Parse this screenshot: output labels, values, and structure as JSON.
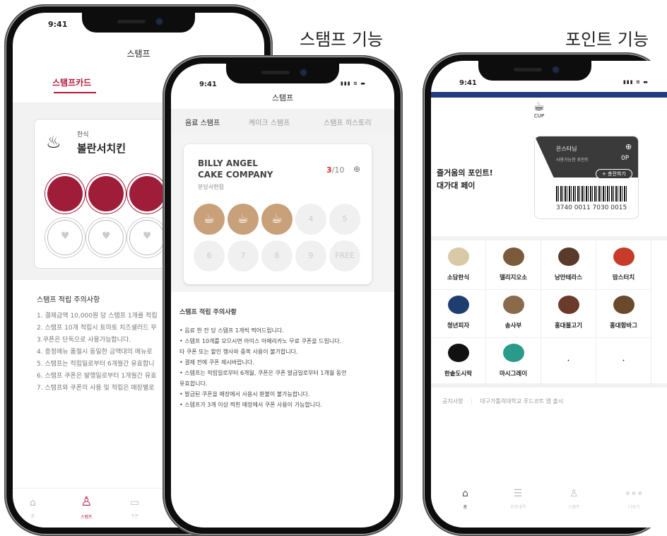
{
  "headings": {
    "stamp": "스탬프 기능",
    "point": "포인트 기능"
  },
  "status": {
    "time": "9:41",
    "icons": "▮▮▮ ≋ ▬"
  },
  "phone1": {
    "title": "스탬프",
    "tab_active": "스탬프카드",
    "store_category": "한식",
    "store_name": "볼란서치킨",
    "heart": "♥",
    "notes_title": "스탬프 적립 주의사항",
    "notes": [
      "1. 결제금액 10,000원 당 스탬프 1개를 적립",
      "2. 스탬프 10개 적립시 토마토 치즈샐러드 무",
      "3.쿠폰은 단독으로 사용가능합니다.",
      "4. 증정메뉴 품절시 동일한 금액대의 메뉴로",
      "5. 스탬프는 적립일로부터 6개월간 유효합니",
      "6. 스탬프 쿠폰은 발행일로부터 1개월간 유효",
      "7. 스탬프와 쿠폰의 사용 및 적립은 매장별로"
    ],
    "nav": [
      "홈",
      "스탬프",
      "쿠폰"
    ]
  },
  "phone2": {
    "title": "스탬프",
    "tabs": [
      "음료 스탬프",
      "케이크 스탬프",
      "스탬프 히스토리"
    ],
    "store_name_1": "BILLY ANGEL",
    "store_name_2": "CAKE COMPANY",
    "branch": "분당서현점",
    "count_current": "3",
    "count_total": "/10",
    "stamps": [
      "",
      "",
      "",
      "4",
      "5",
      "6",
      "7",
      "8",
      "9",
      "FREE"
    ],
    "filled_stamps": 3,
    "notes_title": "스탬프 적립 주의사항",
    "notes": [
      "• 음료 한 잔 당 스탬프 1개씩 찍어드립니다.",
      "• 스탬프 10개를 모으시면 아이스 아메리카노 무료 쿠폰을 드립니다.",
      "  타 쿠폰 또는 할인 행사와 중복 사용이 불가합니다.",
      "• 결제 전에 쿠폰 제시바랍니다.",
      "• 스탬프는 적립일로부터 6개월, 쿠폰은 쿠폰 발급일로부터 1개월 동안",
      "  유효합니다.",
      "• 발급된 쿠폰을 매장에서 사용시 환불이 불가능합니다.",
      "• 스탬프가 3개 이상 찍힌 매장에서 쿠폰 사용이 가능합니다."
    ],
    "accent": "#c8a07a"
  },
  "phone3": {
    "logo_text": "CUP",
    "pay_line1": "즐거움의 포인트!",
    "pay_line2": "대가대 페이",
    "user": "은스타님",
    "points_label": "사용가능한 포인트",
    "points": "0P",
    "charge": "+ 충전하기",
    "barcode_number": "3740 0011 7030 0015",
    "stores": [
      "소담한식",
      "델리지오소",
      "낭만테라스",
      "맘스터치",
      "청년피자",
      "송사부",
      "홍대불고기",
      "홍대함바그",
      "한솥도시락",
      "마시그레이",
      "·",
      "·"
    ],
    "notice_label": "공지사항",
    "notice_text": "대구가톨릭대학교 푸드코트 앱 출시",
    "nav": [
      "홈",
      "주문내역",
      "스탬프",
      "더보기"
    ],
    "brand_color": "#233a7d"
  }
}
